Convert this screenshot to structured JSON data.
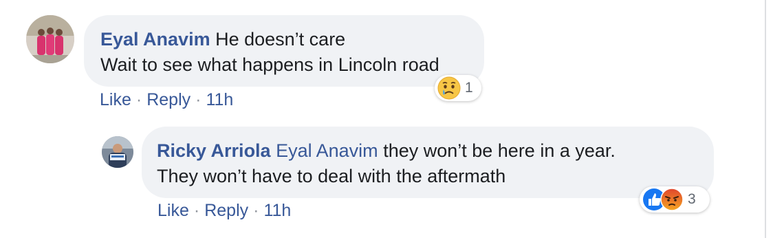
{
  "comments": [
    {
      "author": "Eyal Anavim",
      "text_line1": "He doesn’t care",
      "text_line2": "Wait to see what happens in Lincoln road",
      "actions": {
        "like": "Like",
        "reply": "Reply",
        "time": "11h",
        "separator": "·"
      },
      "reactions": {
        "icons": [
          "sad-icon"
        ],
        "count": "1"
      }
    },
    {
      "author": "Ricky Arriola",
      "mention": "Eyal Anavim",
      "text_line1": "they won’t be here in a year.",
      "text_line2": "They won’t have to deal with the aftermath",
      "actions": {
        "like": "Like",
        "reply": "Reply",
        "time": "11h",
        "separator": "·"
      },
      "reactions": {
        "icons": [
          "like-icon",
          "angry-icon"
        ],
        "count": "3"
      }
    }
  ],
  "colors": {
    "author_link": "#385898",
    "bubble_bg": "#f0f2f5",
    "text": "#1c1e21",
    "like_blue": "#1877f2",
    "angry_orange": "#e9710f"
  }
}
